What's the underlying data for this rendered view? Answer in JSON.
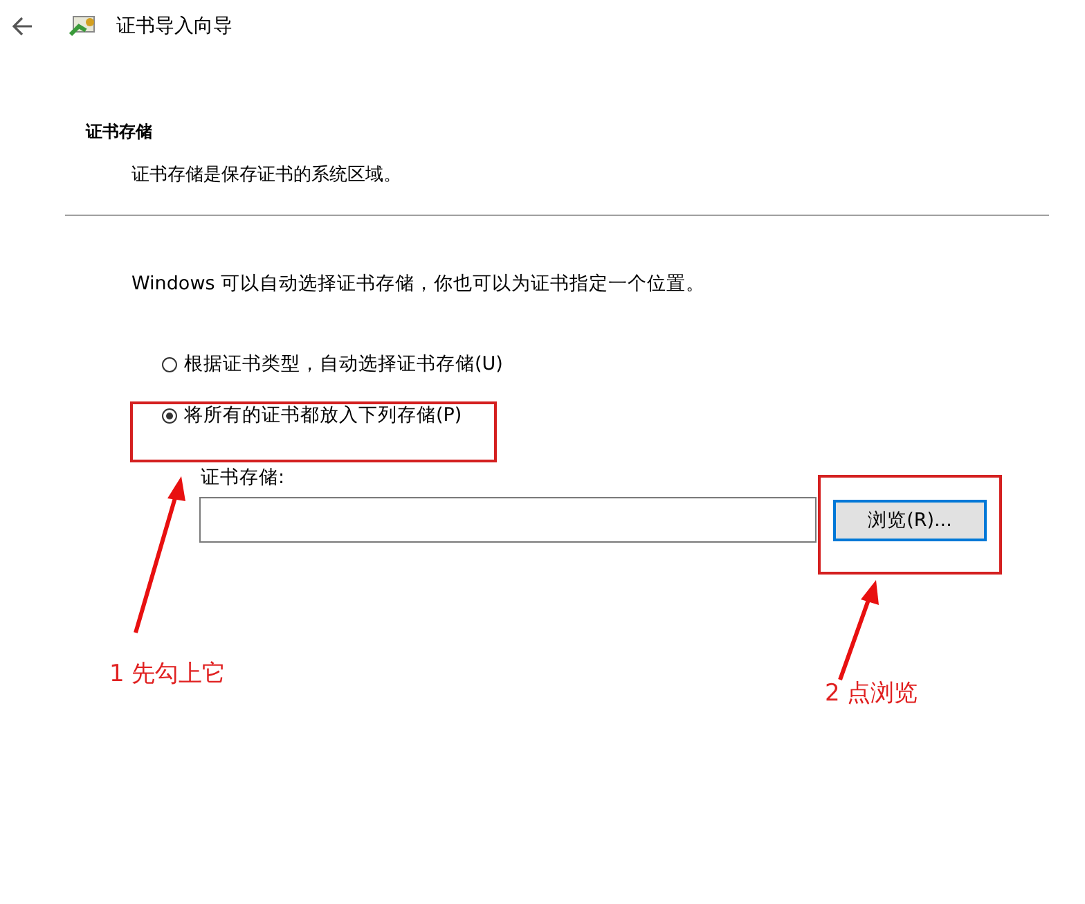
{
  "window": {
    "title": "证书导入向导"
  },
  "section": {
    "heading": "证书存储",
    "description": "证书存储是保存证书的系统区域。"
  },
  "intro": "Windows 可以自动选择证书存储，你也可以为证书指定一个位置。",
  "options": [
    {
      "label": "根据证书类型，自动选择证书存储(U)",
      "selected": false
    },
    {
      "label": "将所有的证书都放入下列存储(P)",
      "selected": true
    }
  ],
  "store_field": {
    "label": "证书存储:"
  },
  "browse_button": "浏览(R)...",
  "annotations": [
    {
      "text": "1 先勾上它"
    },
    {
      "text": "2 点浏览"
    }
  ]
}
